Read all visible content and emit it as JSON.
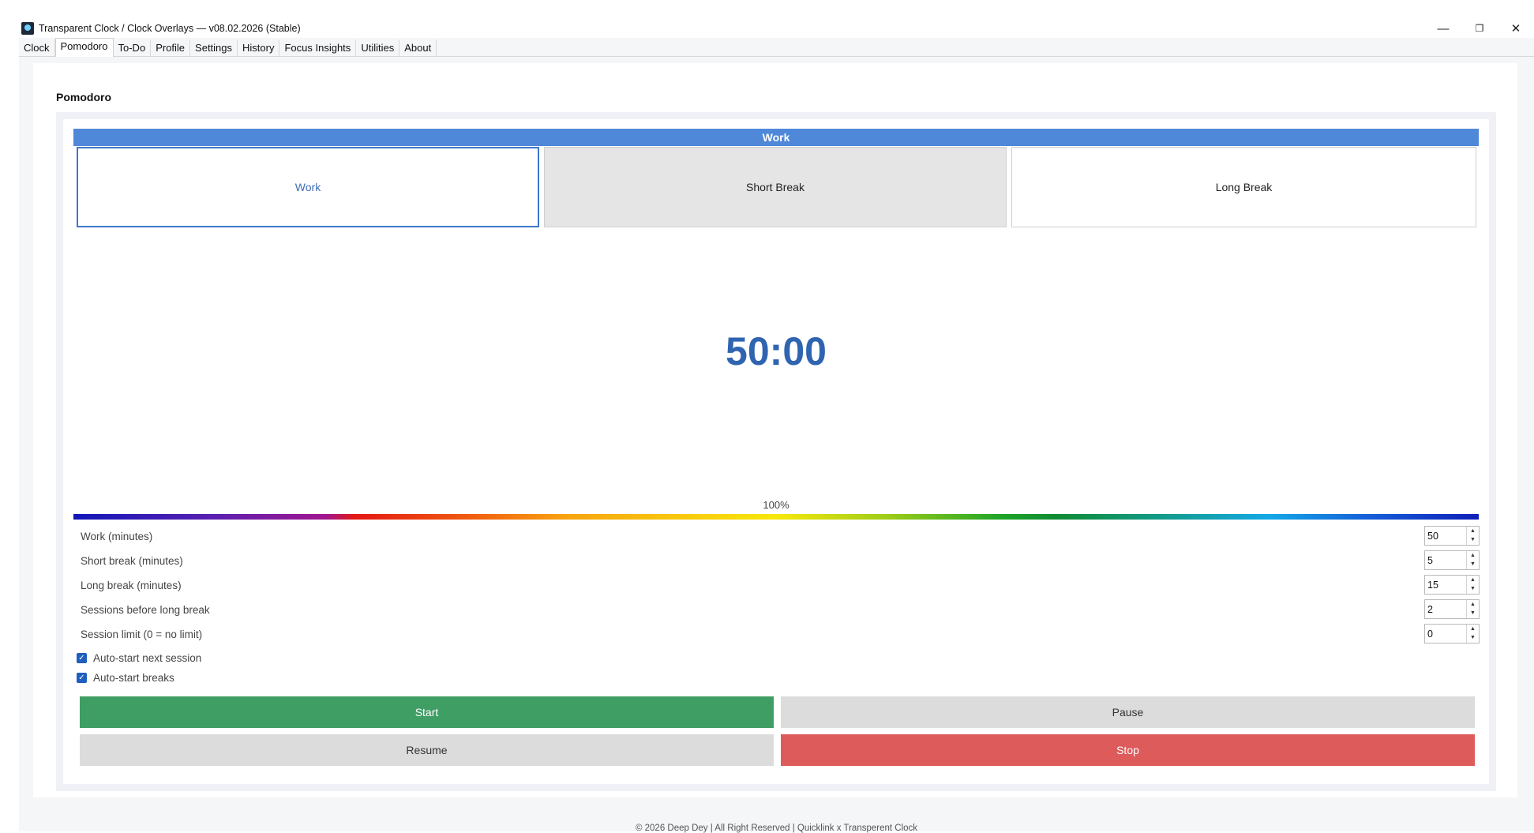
{
  "window": {
    "title": "Transparent Clock / Clock Overlays — v08.02.2026 (Stable)",
    "minimize_glyph": "—",
    "restore_glyph": "❐",
    "close_glyph": "✕"
  },
  "tabs": [
    {
      "label": "Clock"
    },
    {
      "label": "Pomodoro"
    },
    {
      "label": "To-Do"
    },
    {
      "label": "Profile"
    },
    {
      "label": "Settings"
    },
    {
      "label": "History"
    },
    {
      "label": "Focus Insights"
    },
    {
      "label": "Utilities"
    },
    {
      "label": "About"
    }
  ],
  "active_tab": "Pomodoro",
  "page": {
    "title": "Pomodoro"
  },
  "pomodoro": {
    "current_mode": "Work",
    "modes": {
      "work": "Work",
      "short_break": "Short Break",
      "long_break": "Long Break"
    },
    "timer": "50:00",
    "progress_label": "100%",
    "progress_value": 1.0,
    "settings": [
      {
        "label": "Work (minutes)",
        "value": "50"
      },
      {
        "label": "Short break (minutes)",
        "value": "5"
      },
      {
        "label": "Long break (minutes)",
        "value": "15"
      },
      {
        "label": "Sessions before long break",
        "value": "2"
      },
      {
        "label": "Session limit (0 = no limit)",
        "value": "0"
      }
    ],
    "checks": [
      {
        "label": "Auto-start next session",
        "checked": true
      },
      {
        "label": "Auto-start breaks",
        "checked": true
      }
    ],
    "buttons": {
      "start": "Start",
      "pause": "Pause",
      "resume": "Resume",
      "stop": "Stop"
    }
  },
  "colors": {
    "accent": "#4f88d9",
    "timer": "#2f64b0",
    "start": "#3f9e63",
    "stop": "#dd5b5b",
    "neutral_button": "#dcdcdc"
  },
  "footer": "© 2026 Deep Dey | All Right Reserved | Quicklink x Transperent Clock"
}
